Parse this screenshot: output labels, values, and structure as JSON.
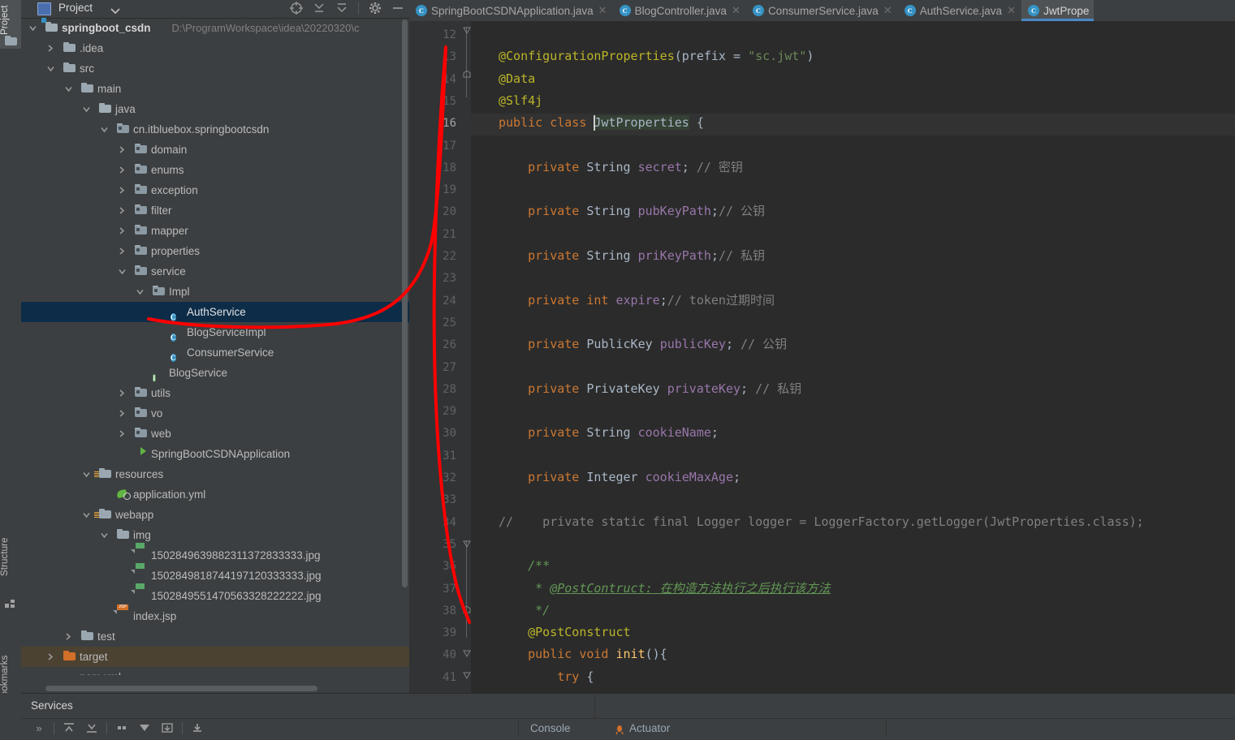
{
  "window": {
    "left_strip": {
      "project_label": "Project",
      "structure_label": "Structure",
      "bookmarks_label": "Bookmarks"
    }
  },
  "project_panel": {
    "title": "Project",
    "toolbar": [
      {
        "name": "locate-icon",
        "tip": "Select Opened File"
      },
      {
        "name": "expand-all-icon",
        "tip": "Expand All"
      },
      {
        "name": "collapse-all-icon",
        "tip": "Collapse All"
      },
      {
        "name": "gear-icon",
        "tip": "Options"
      },
      {
        "name": "minimize-icon",
        "tip": "Hide"
      }
    ],
    "tree": [
      {
        "label": "springboot_csdn",
        "path": "D:\\ProgramWorkspace\\idea\\20220320\\c",
        "indent": 0,
        "arrow": "down",
        "icon": "module-folder",
        "bold": true
      },
      {
        "label": ".idea",
        "indent": 1,
        "arrow": "right",
        "icon": "folder"
      },
      {
        "label": "src",
        "indent": 1,
        "arrow": "down",
        "icon": "folder"
      },
      {
        "label": "main",
        "indent": 2,
        "arrow": "down",
        "icon": "folder"
      },
      {
        "label": "java",
        "indent": 3,
        "arrow": "down",
        "icon": "source-folder"
      },
      {
        "label": "cn.itbluebox.springbootcsdn",
        "indent": 4,
        "arrow": "down",
        "icon": "package"
      },
      {
        "label": "domain",
        "indent": 5,
        "arrow": "right",
        "icon": "package"
      },
      {
        "label": "enums",
        "indent": 5,
        "arrow": "right",
        "icon": "package"
      },
      {
        "label": "exception",
        "indent": 5,
        "arrow": "right",
        "icon": "package"
      },
      {
        "label": "filter",
        "indent": 5,
        "arrow": "right",
        "icon": "package"
      },
      {
        "label": "mapper",
        "indent": 5,
        "arrow": "right",
        "icon": "package"
      },
      {
        "label": "properties",
        "indent": 5,
        "arrow": "right",
        "icon": "package"
      },
      {
        "label": "service",
        "indent": 5,
        "arrow": "down",
        "icon": "package"
      },
      {
        "label": "Impl",
        "indent": 6,
        "arrow": "down",
        "icon": "package"
      },
      {
        "label": "AuthService",
        "indent": 7,
        "arrow": "none",
        "icon": "class",
        "selected": true
      },
      {
        "label": "BlogServiceImpl",
        "indent": 7,
        "arrow": "none",
        "icon": "class"
      },
      {
        "label": "ConsumerService",
        "indent": 7,
        "arrow": "none",
        "icon": "class"
      },
      {
        "label": "BlogService",
        "indent": 6,
        "arrow": "none",
        "icon": "interface"
      },
      {
        "label": "utils",
        "indent": 5,
        "arrow": "right",
        "icon": "package"
      },
      {
        "label": "vo",
        "indent": 5,
        "arrow": "right",
        "icon": "package"
      },
      {
        "label": "web",
        "indent": 5,
        "arrow": "right",
        "icon": "package"
      },
      {
        "label": "SpringBootCSDNApplication",
        "indent": 5,
        "arrow": "none",
        "icon": "spring-class"
      },
      {
        "label": "resources",
        "indent": 3,
        "arrow": "down",
        "icon": "resource-folder"
      },
      {
        "label": "application.yml",
        "indent": 4,
        "arrow": "none",
        "icon": "yml"
      },
      {
        "label": "webapp",
        "indent": 3,
        "arrow": "down",
        "icon": "resource-folder"
      },
      {
        "label": "img",
        "indent": 4,
        "arrow": "down",
        "icon": "folder"
      },
      {
        "label": "1502849639882311372833333.jpg",
        "indent": 5,
        "arrow": "none",
        "icon": "jpg"
      },
      {
        "label": "1502849818744197120333333.jpg",
        "indent": 5,
        "arrow": "none",
        "icon": "jpg"
      },
      {
        "label": "1502849551470563328222222.jpg",
        "indent": 5,
        "arrow": "none",
        "icon": "jpg"
      },
      {
        "label": "index.jsp",
        "indent": 4,
        "arrow": "none",
        "icon": "jsp"
      },
      {
        "label": "test",
        "indent": 2,
        "arrow": "right",
        "icon": "folder"
      },
      {
        "label": "target",
        "indent": 1,
        "arrow": "right",
        "icon": "orange-folder",
        "highlighted": true
      },
      {
        "label": "pom.xml",
        "indent": 1,
        "arrow": "none",
        "icon": "maven"
      }
    ]
  },
  "editor": {
    "tabs": [
      {
        "label": "SpringBootCSDNApplication.java",
        "icon": "class-icon",
        "active": false,
        "closable": true
      },
      {
        "label": "BlogController.java",
        "icon": "class-icon",
        "active": false,
        "closable": true
      },
      {
        "label": "ConsumerService.java",
        "icon": "class-icon",
        "active": false,
        "closable": true
      },
      {
        "label": "AuthService.java",
        "icon": "class-icon",
        "active": false,
        "closable": true
      },
      {
        "label": "JwtPrope",
        "icon": "class-icon",
        "active": true,
        "closable": false
      }
    ],
    "first_line_number": 12,
    "current_line": 16,
    "line_numbers": [
      12,
      13,
      14,
      15,
      16,
      17,
      18,
      19,
      20,
      21,
      22,
      23,
      24,
      25,
      26,
      27,
      28,
      29,
      30,
      31,
      32,
      33,
      34,
      35,
      36,
      37,
      38,
      39,
      40,
      41
    ],
    "lines": [
      {
        "n": 12,
        "tokens": []
      },
      {
        "n": 13,
        "tokens": [
          {
            "t": "@ConfigurationProperties",
            "c": "an"
          },
          {
            "t": "(",
            "c": "pn"
          },
          {
            "t": "prefix",
            "c": "ty"
          },
          {
            "t": " = ",
            "c": "pn"
          },
          {
            "t": "\"sc.jwt\"",
            "c": "st"
          },
          {
            "t": ")",
            "c": "pn"
          }
        ]
      },
      {
        "n": 14,
        "tokens": [
          {
            "t": "@Data",
            "c": "an"
          }
        ]
      },
      {
        "n": 15,
        "tokens": [
          {
            "t": "@Slf4j",
            "c": "an"
          }
        ]
      },
      {
        "n": 16,
        "tokens": [
          {
            "t": "public",
            "c": "k"
          },
          {
            "t": " ",
            "c": "pn"
          },
          {
            "t": "class",
            "c": "k"
          },
          {
            "t": " ",
            "c": "pn"
          },
          {
            "t": "JwtProperties",
            "c": "sel-tok ty"
          },
          {
            "t": " {",
            "c": "pn"
          }
        ]
      },
      {
        "n": 17,
        "tokens": []
      },
      {
        "n": 18,
        "tokens": [
          {
            "t": "    private",
            "c": "k"
          },
          {
            "t": " ",
            "c": "pn"
          },
          {
            "t": "String",
            "c": "ty"
          },
          {
            "t": " ",
            "c": "pn"
          },
          {
            "t": "secret",
            "c": "fl"
          },
          {
            "t": "; ",
            "c": "pn"
          },
          {
            "t": "// 密钥",
            "c": "cm"
          }
        ]
      },
      {
        "n": 19,
        "tokens": []
      },
      {
        "n": 20,
        "tokens": [
          {
            "t": "    private",
            "c": "k"
          },
          {
            "t": " ",
            "c": "pn"
          },
          {
            "t": "String",
            "c": "ty"
          },
          {
            "t": " ",
            "c": "pn"
          },
          {
            "t": "pubKeyPath",
            "c": "fl"
          },
          {
            "t": ";",
            "c": "pn"
          },
          {
            "t": "// 公钥",
            "c": "cm"
          }
        ]
      },
      {
        "n": 21,
        "tokens": []
      },
      {
        "n": 22,
        "tokens": [
          {
            "t": "    private",
            "c": "k"
          },
          {
            "t": " ",
            "c": "pn"
          },
          {
            "t": "String",
            "c": "ty"
          },
          {
            "t": " ",
            "c": "pn"
          },
          {
            "t": "priKeyPath",
            "c": "fl"
          },
          {
            "t": ";",
            "c": "pn"
          },
          {
            "t": "// 私钥",
            "c": "cm"
          }
        ]
      },
      {
        "n": 23,
        "tokens": []
      },
      {
        "n": 24,
        "tokens": [
          {
            "t": "    private",
            "c": "k"
          },
          {
            "t": " ",
            "c": "pn"
          },
          {
            "t": "int",
            "c": "k"
          },
          {
            "t": " ",
            "c": "pn"
          },
          {
            "t": "expire",
            "c": "fl"
          },
          {
            "t": ";",
            "c": "pn"
          },
          {
            "t": "// token过期时间",
            "c": "cm"
          }
        ]
      },
      {
        "n": 25,
        "tokens": []
      },
      {
        "n": 26,
        "tokens": [
          {
            "t": "    private",
            "c": "k"
          },
          {
            "t": " ",
            "c": "pn"
          },
          {
            "t": "PublicKey",
            "c": "ty"
          },
          {
            "t": " ",
            "c": "pn"
          },
          {
            "t": "publicKey",
            "c": "fl"
          },
          {
            "t": "; ",
            "c": "pn"
          },
          {
            "t": "// 公钥",
            "c": "cm"
          }
        ]
      },
      {
        "n": 27,
        "tokens": []
      },
      {
        "n": 28,
        "tokens": [
          {
            "t": "    private",
            "c": "k"
          },
          {
            "t": " ",
            "c": "pn"
          },
          {
            "t": "PrivateKey",
            "c": "ty"
          },
          {
            "t": " ",
            "c": "pn"
          },
          {
            "t": "privateKey",
            "c": "fl"
          },
          {
            "t": "; ",
            "c": "pn"
          },
          {
            "t": "// 私钥",
            "c": "cm"
          }
        ]
      },
      {
        "n": 29,
        "tokens": []
      },
      {
        "n": 30,
        "tokens": [
          {
            "t": "    private",
            "c": "k"
          },
          {
            "t": " ",
            "c": "pn"
          },
          {
            "t": "String",
            "c": "ty"
          },
          {
            "t": " ",
            "c": "pn"
          },
          {
            "t": "cookieName",
            "c": "fl"
          },
          {
            "t": ";",
            "c": "pn"
          }
        ]
      },
      {
        "n": 31,
        "tokens": []
      },
      {
        "n": 32,
        "tokens": [
          {
            "t": "    private",
            "c": "k"
          },
          {
            "t": " ",
            "c": "pn"
          },
          {
            "t": "Integer",
            "c": "ty"
          },
          {
            "t": " ",
            "c": "pn"
          },
          {
            "t": "cookieMaxAge",
            "c": "fl"
          },
          {
            "t": ";",
            "c": "pn"
          }
        ]
      },
      {
        "n": 33,
        "tokens": []
      },
      {
        "n": 34,
        "tokens": [
          {
            "t": "//    private static final Logger logger = LoggerFactory.getLogger(JwtProperties.class);",
            "c": "cm"
          }
        ]
      },
      {
        "n": 35,
        "tokens": []
      },
      {
        "n": 36,
        "tokens": [
          {
            "t": "    /**",
            "c": "jd"
          }
        ]
      },
      {
        "n": 37,
        "tokens": [
          {
            "t": "     * ",
            "c": "jd"
          },
          {
            "t": "@PostContruct: 在构造方法执行之后执行该方法",
            "c": "jdl"
          }
        ]
      },
      {
        "n": 38,
        "tokens": [
          {
            "t": "     */",
            "c": "jd"
          }
        ]
      },
      {
        "n": 39,
        "tokens": [
          {
            "t": "    @PostConstruct",
            "c": "an"
          }
        ]
      },
      {
        "n": 40,
        "tokens": [
          {
            "t": "    public",
            "c": "k"
          },
          {
            "t": " ",
            "c": "pn"
          },
          {
            "t": "void",
            "c": "k"
          },
          {
            "t": " ",
            "c": "pn"
          },
          {
            "t": "init",
            "c": "mt"
          },
          {
            "t": "(){",
            "c": "pn"
          }
        ]
      },
      {
        "n": 41,
        "tokens": [
          {
            "t": "        try",
            "c": "k"
          },
          {
            "t": " {",
            "c": "pn"
          }
        ]
      }
    ]
  },
  "services": {
    "title": "Services",
    "expand_label": "»",
    "toolbar": [
      {
        "name": "expand-all-icon"
      },
      {
        "name": "collapse-all-icon"
      },
      {
        "name": "pause-icon"
      },
      {
        "name": "filter-icon"
      },
      {
        "name": "export-icon"
      },
      {
        "name": "scroll-to-end-icon"
      }
    ],
    "tabs": [
      {
        "label": "Console",
        "icon": "console-icon"
      },
      {
        "label": "Actuator",
        "icon": "actuator-icon"
      }
    ]
  },
  "annotation": {
    "color": "#ff0000",
    "shape": "hand-drawn-curve"
  },
  "colors": {
    "panel_bg": "#3c3f41",
    "editor_bg": "#2b2b2b",
    "gutter_bg": "#313335",
    "selection": "#0d2c47",
    "accent": "#4a88c7",
    "annotation_red": "#ff0000"
  }
}
